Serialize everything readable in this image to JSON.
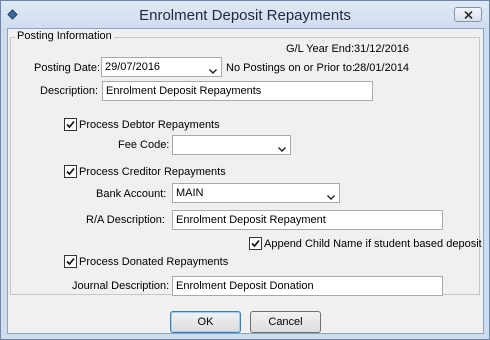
{
  "window": {
    "title": "Enrolment Deposit Repayments"
  },
  "group": {
    "legend": "Posting Information"
  },
  "gl_year_end": {
    "label": "G/L Year End:",
    "value": "31/12/2016"
  },
  "posting_date": {
    "label": "Posting Date:",
    "value": "29/07/2016"
  },
  "no_postings": {
    "label": "No Postings on or Prior to:",
    "value": "28/01/2014"
  },
  "description": {
    "label": "Description:",
    "value": "Enrolment Deposit Repayments"
  },
  "debtor": {
    "label": "Process Debtor Repayments",
    "checked": true
  },
  "fee_code": {
    "label": "Fee Code:",
    "value": ""
  },
  "creditor": {
    "label": "Process Creditor Repayments",
    "checked": true
  },
  "bank_account": {
    "label": "Bank Account:",
    "value": "MAIN"
  },
  "ra_description": {
    "label": "R/A Description:",
    "value": "Enrolment Deposit Repayment"
  },
  "append_child": {
    "label": "Append Child Name if student based deposit",
    "checked": true
  },
  "donated": {
    "label": "Process Donated Repayments",
    "checked": true
  },
  "journal_description": {
    "label": "Journal Description:",
    "value": "Enrolment Deposit Donation"
  },
  "buttons": {
    "ok": "OK",
    "cancel": "Cancel"
  },
  "icons": {
    "app": "app-icon",
    "close": "close-icon",
    "dropdown": "chevron-down-icon",
    "check": "checkmark-icon"
  }
}
